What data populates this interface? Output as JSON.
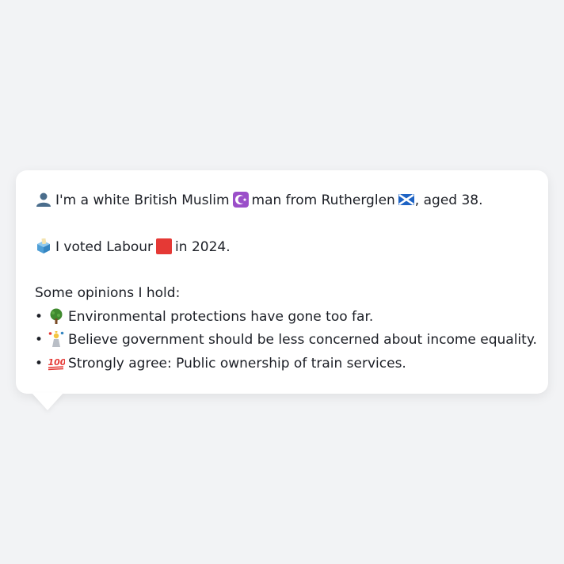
{
  "profile": {
    "intro_part1": "I'm a white British Muslim",
    "intro_part2": "man from Rutherglen",
    "intro_part3": ", aged 38.",
    "vote_part1": "I voted Labour",
    "vote_part2": "in 2024.",
    "opinions_heading": "Some opinions I hold:",
    "bullet_char": "•",
    "opinions": [
      {
        "icon": "tree-icon",
        "text": "Environmental protections have gone too far."
      },
      {
        "icon": "person-juggling-icon",
        "text": "Believe government should be less concerned about income equality."
      },
      {
        "icon": "hundred-points-icon",
        "text": "Strongly agree: Public ownership of train services."
      }
    ]
  },
  "icons": {
    "person": "bust-in-silhouette-icon",
    "religion": "star-and-crescent-icon",
    "flag": "scotland-flag-icon",
    "ballot": "ballot-box-icon",
    "party": "red-square-icon"
  },
  "colors": {
    "background": "#f2f3f5",
    "bubble": "#ffffff",
    "text": "#1c1f26",
    "religion_badge": "#9b4fc9",
    "party_square": "#e53935",
    "flag_blue": "#1e63c4"
  }
}
